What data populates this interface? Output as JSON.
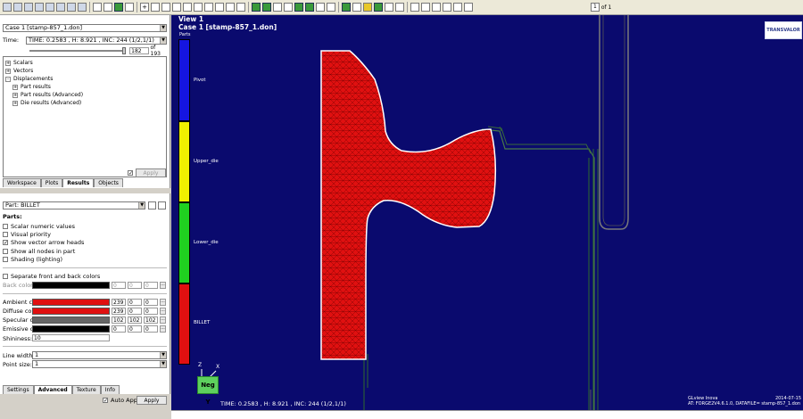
{
  "left_panel": {
    "case_select": "Case 1 [stamp-857_1.don]",
    "time_label": "Time:",
    "time_value": "TIME: 0.2583    , H:  8.921    , INC:  244 (1/2,1/1)",
    "frame_value": "182",
    "frame_total": "of 193",
    "tree": [
      {
        "label": "Scalars",
        "expander": "+",
        "indent": 0
      },
      {
        "label": "Vectors",
        "expander": "+",
        "indent": 0
      },
      {
        "label": "Displacements",
        "expander": "-",
        "indent": 0
      },
      {
        "label": "Part results",
        "expander": "+",
        "indent": 1
      },
      {
        "label": "Part results (Advanced)",
        "expander": "+",
        "indent": 1
      },
      {
        "label": "Die results (Advanced)",
        "expander": "+",
        "indent": 1
      }
    ],
    "apply_label": "Apply",
    "top_tabs": [
      "Workspace",
      "Plots",
      "Results",
      "Objects"
    ],
    "active_top_tab": "Results",
    "part_select": "Part: BILLET",
    "parts_heading": "Parts:",
    "checkboxes": [
      {
        "label": "Scalar numeric values",
        "checked": false
      },
      {
        "label": "Visual priority",
        "checked": false
      },
      {
        "label": "Show vector arrow heads",
        "checked": true
      },
      {
        "label": "Show all nodes in part",
        "checked": false
      },
      {
        "label": "Shading (lighting)",
        "checked": false
      }
    ],
    "separate_colors": {
      "label": "Separate front and back colors",
      "checked": false
    },
    "back_color": {
      "label": "Back color:",
      "r": "0",
      "g": "0",
      "b": "0",
      "swatch": "#000000"
    },
    "colors": [
      {
        "label": "Ambient color:",
        "swatch": "#e01010",
        "r": "239",
        "g": "0",
        "b": "0"
      },
      {
        "label": "Diffuse color:",
        "swatch": "#e01010",
        "r": "239",
        "g": "0",
        "b": "0"
      },
      {
        "label": "Specular color:",
        "swatch": "#666666",
        "r": "102",
        "g": "102",
        "b": "102"
      },
      {
        "label": "Emissive color:",
        "swatch": "#000000",
        "r": "0",
        "g": "0",
        "b": "0"
      }
    ],
    "shininess_label": "Shininess:",
    "shininess_value": "10",
    "line_width_label": "Line width:",
    "line_width_value": "1",
    "point_size_label": "Point size:",
    "point_size_value": "1",
    "bottom_tabs": [
      "Settings",
      "Advanced",
      "Texture",
      "Info"
    ],
    "active_bottom_tab": "Advanced",
    "auto_apply_label": "Auto Apply",
    "auto_apply_checked": true,
    "apply_button": "Apply"
  },
  "toolbar": {
    "frame_input": "1",
    "frame_of": "of 1"
  },
  "viewport": {
    "title": "View 1",
    "case_title": "Case 1 [stamp-857_1.don]",
    "legend_title": "Parts",
    "legend": [
      {
        "name": "Pivot",
        "color": "#1515e0"
      },
      {
        "name": "Upper_die",
        "color": "#f0f000"
      },
      {
        "name": "Lower_die",
        "color": "#20d020"
      },
      {
        "name": "BILLET",
        "color": "#e01010"
      }
    ],
    "bottom_time": "TIME: 0.2583    , H:  8.921    , INC:   244 (1/2,1/1)",
    "axis_view_label": "Neg Y",
    "axis_z": "Z",
    "axis_x": "X",
    "logo_text": "TRANSVALOR",
    "info_line1": "GLview Inova",
    "info_date": "2014-07-15",
    "info_line2": "AT:      FORGE2V4.6.1.0, DATAFILE=   stamp-857_1.don"
  },
  "colors": {
    "viewport_bg": "#0a0a6e",
    "billet_red": "#e01010",
    "die_green": "#2a5a2a"
  }
}
